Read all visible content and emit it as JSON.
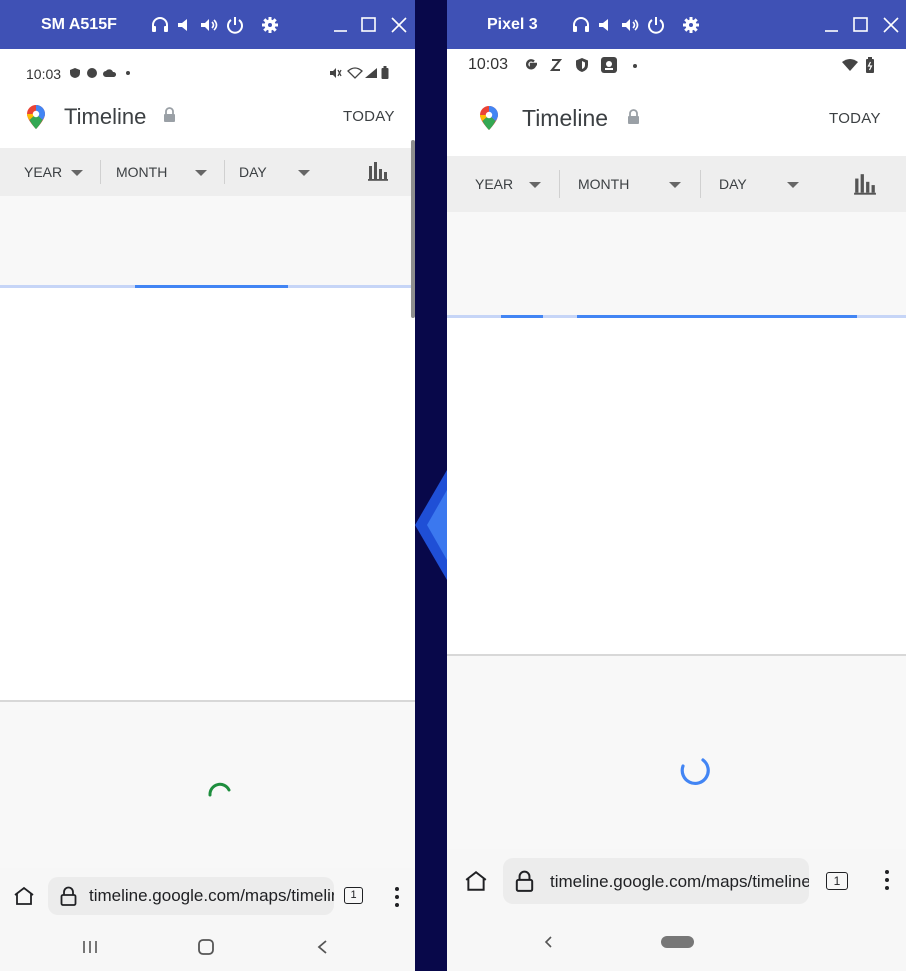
{
  "left_window": {
    "device_name": "SM A515F",
    "status_time": "10:03",
    "app_title": "Timeline",
    "today_label": "TODAY",
    "filters": {
      "year": "YEAR",
      "month": "MONTH",
      "day": "DAY"
    },
    "url": "timeline.google.com/maps/timeline",
    "tab_count": "1",
    "spinner_color": "#1e8e3e"
  },
  "right_window": {
    "device_name": "Pixel 3",
    "status_time": "10:03",
    "app_title": "Timeline",
    "today_label": "TODAY",
    "filters": {
      "year": "YEAR",
      "month": "MONTH",
      "day": "DAY"
    },
    "url": "timeline.google.com/maps/timeline",
    "tab_count": "1",
    "spinner_color": "#4285f4"
  },
  "colors": {
    "titlebar": "#3f51b5",
    "desktop": "#08084a",
    "progress": "#4285f4"
  }
}
